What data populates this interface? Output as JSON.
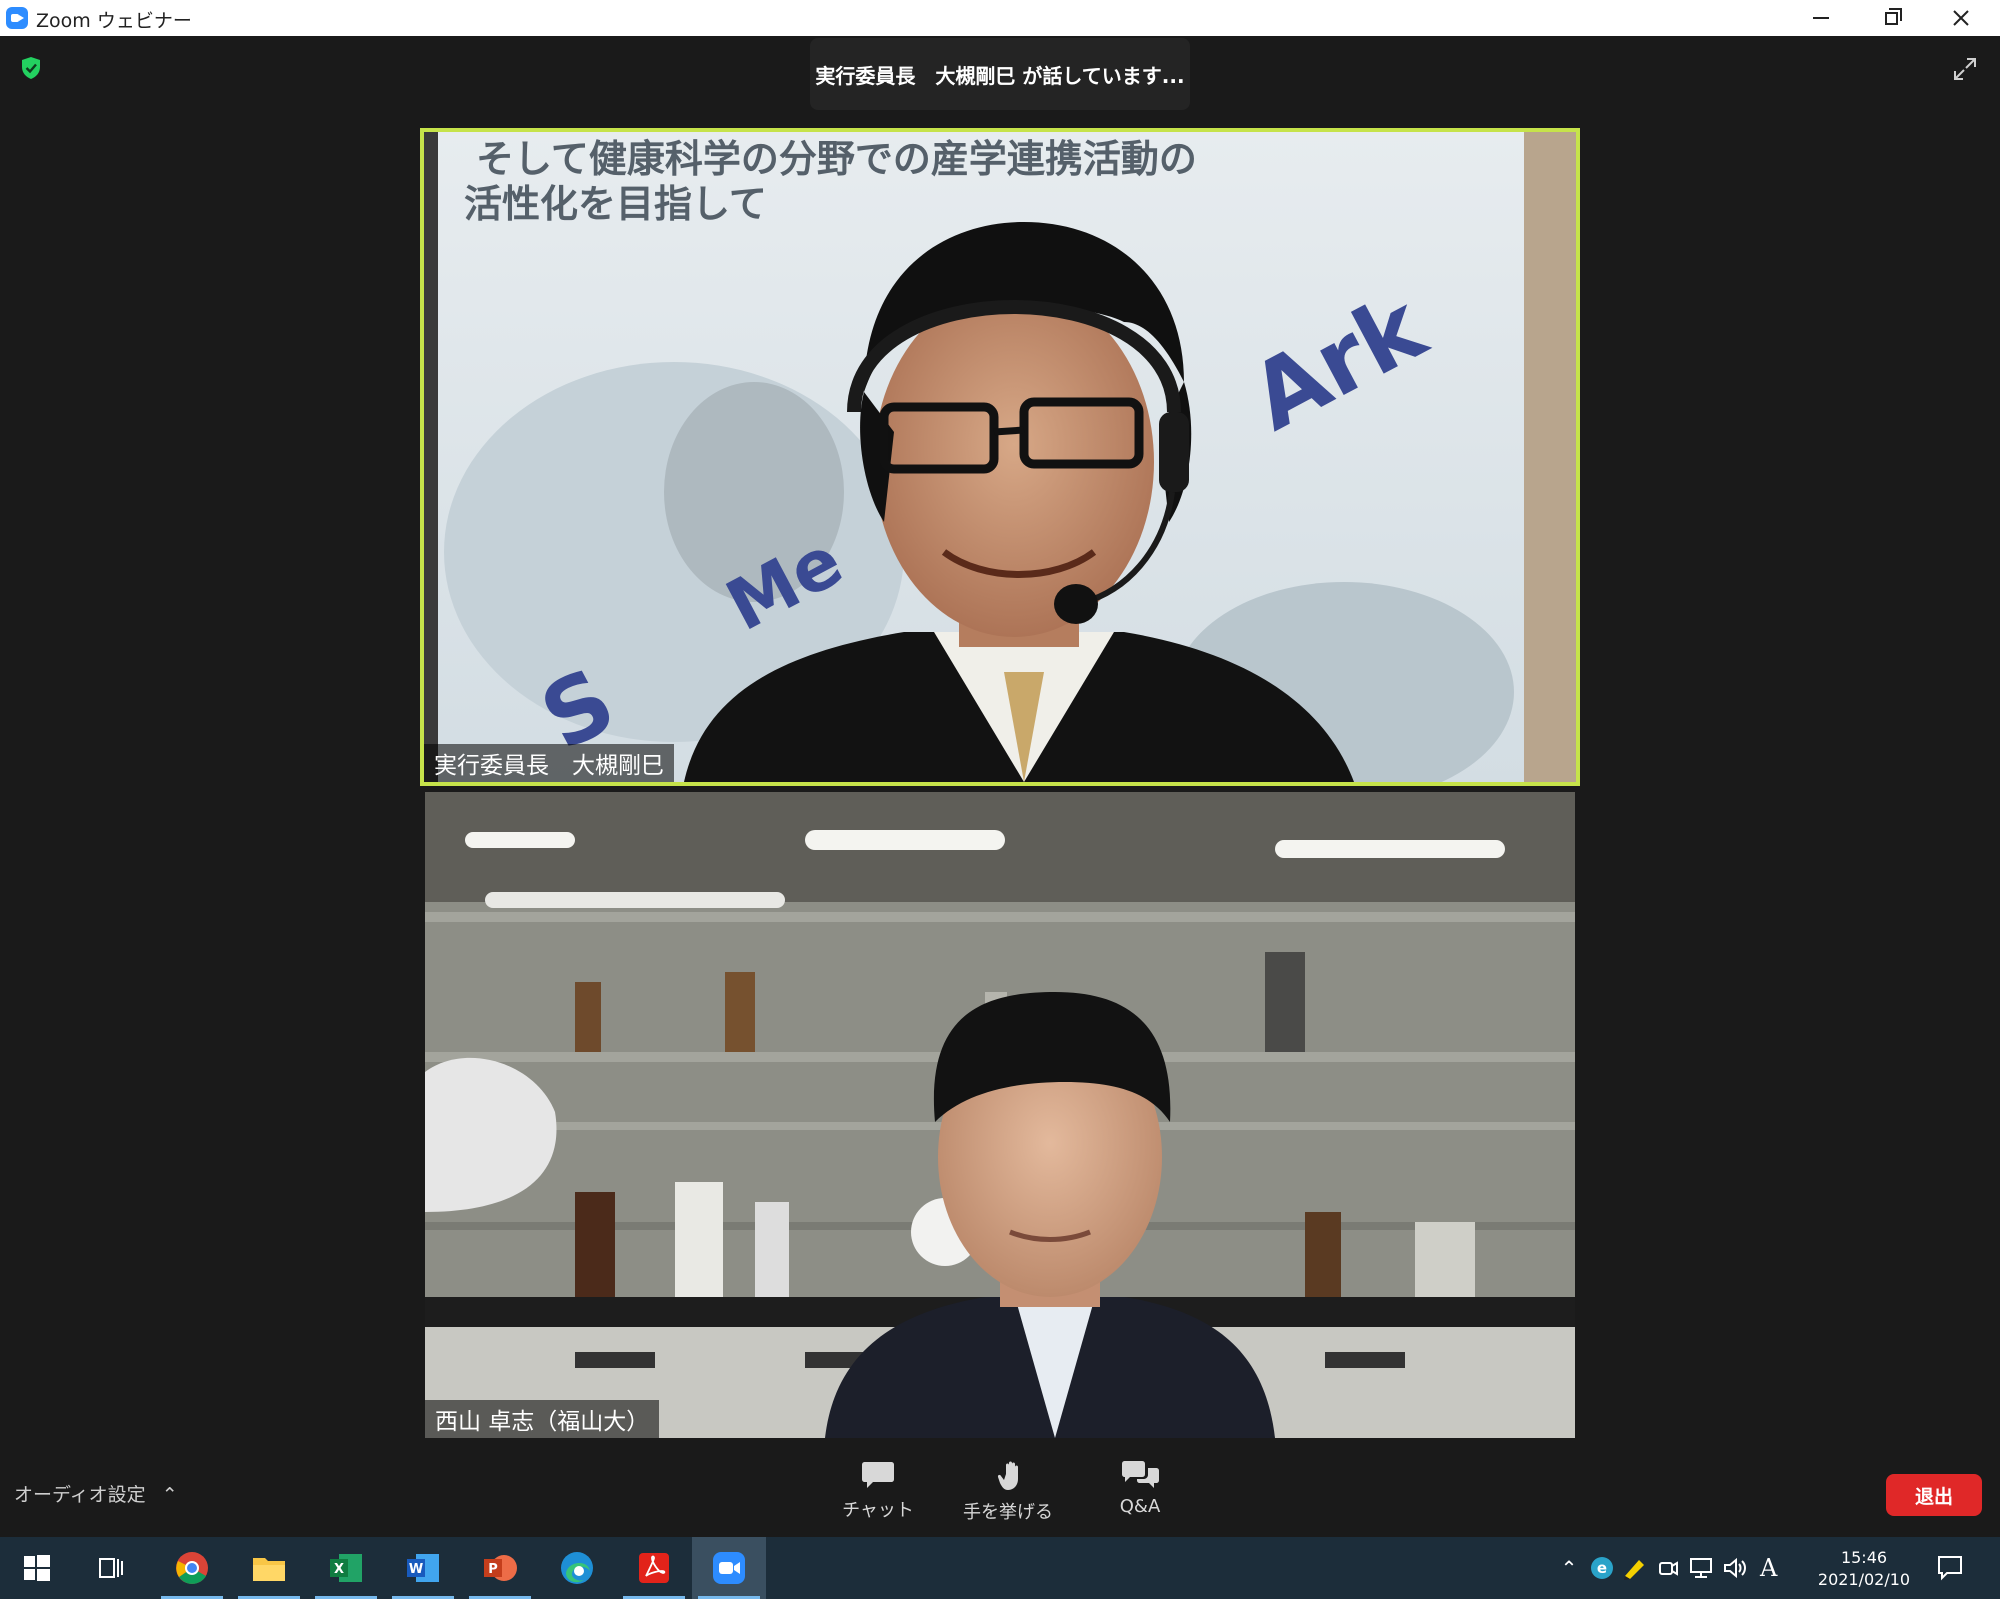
{
  "window": {
    "title": "Zoom ウェビナー"
  },
  "banner": {
    "speaking_text": "実行委員長　大槻剛巳 が話しています..."
  },
  "videos": [
    {
      "name": "実行委員長　大槻剛巳",
      "active_speaker": true,
      "slide_text_line1": "そして健康科学の分野での産学連携活動の",
      "slide_text_line2": "活性化を目指して",
      "slide_text_brand": "Ark"
    },
    {
      "name": "西山 卓志（福山大）",
      "active_speaker": false
    }
  ],
  "controls": {
    "audio_settings": "オーディオ設定",
    "chat": "チャット",
    "raise_hand": "手を挙げる",
    "qa": "Q&A",
    "leave": "退出"
  },
  "taskbar": {
    "time": "15:46",
    "date": "2021/02/10",
    "ime_indicator": "A",
    "apps": [
      "start-icon",
      "task-view-icon",
      "chrome-icon",
      "file-explorer-icon",
      "excel-icon",
      "word-icon",
      "powerpoint-icon",
      "edge-icon",
      "acrobat-icon",
      "zoom-icon"
    ],
    "active_app": "zoom-icon"
  },
  "colors": {
    "active_speaker_border": "#c6e34a",
    "leave_button": "#e02828",
    "zoom_blue": "#2d8cff",
    "background": "#1a1a1a",
    "taskbar": "#1c2d3a"
  }
}
